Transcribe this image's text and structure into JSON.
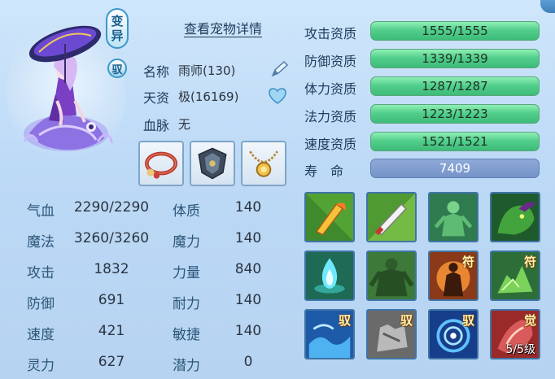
{
  "header": {
    "detail_link": "查看宠物详情",
    "mutant_badge": [
      "变",
      "异"
    ],
    "tame_badge": "驭"
  },
  "pet_info": {
    "name_label": "名称",
    "name_value": "雨师(130)",
    "talent_label": "天资",
    "talent_value": "极(16169)",
    "bloodline_label": "血脉",
    "bloodline_value": "无"
  },
  "equipment": [
    {
      "name": "collar",
      "color": "#b8362e"
    },
    {
      "name": "armor",
      "color": "#4a5b6e"
    },
    {
      "name": "necklace",
      "color": "#d9a23c"
    }
  ],
  "stats": [
    {
      "label": "气血",
      "value": "2290/2290",
      "label2": "体质",
      "value2": "140"
    },
    {
      "label": "魔法",
      "value": "3260/3260",
      "label2": "魔力",
      "value2": "140"
    },
    {
      "label": "攻击",
      "value": "1832",
      "label2": "力量",
      "value2": "840"
    },
    {
      "label": "防御",
      "value": "691",
      "label2": "耐力",
      "value2": "140"
    },
    {
      "label": "速度",
      "value": "421",
      "label2": "敏捷",
      "value2": "140"
    },
    {
      "label": "灵力",
      "value": "627",
      "label2": "潜力",
      "value2": "0"
    }
  ],
  "aptitudes": [
    {
      "label": "攻击资质",
      "value": "1555/1555"
    },
    {
      "label": "防御资质",
      "value": "1339/1339"
    },
    {
      "label": "体力资质",
      "value": "1287/1287"
    },
    {
      "label": "法力资质",
      "value": "1223/1223"
    },
    {
      "label": "速度资质",
      "value": "1521/1521"
    }
  ],
  "lifespan": {
    "label": "寿　命",
    "value": "7409"
  },
  "skills": [
    {
      "icon": "flame-sword-icon",
      "tag": "",
      "level": ""
    },
    {
      "icon": "blade-strike-icon",
      "tag": "",
      "level": ""
    },
    {
      "icon": "green-figure-icon",
      "tag": "",
      "level": ""
    },
    {
      "icon": "shadow-beast-icon",
      "tag": "",
      "level": ""
    },
    {
      "icon": "blue-flame-icon",
      "tag": "",
      "level": ""
    },
    {
      "icon": "giant-icon",
      "tag": "",
      "level": ""
    },
    {
      "icon": "fire-warrior-icon",
      "tag": "符",
      "level": ""
    },
    {
      "icon": "green-burst-icon",
      "tag": "符",
      "level": ""
    },
    {
      "icon": "water-wave-icon",
      "tag": "驭",
      "level": ""
    },
    {
      "icon": "stone-hand-icon",
      "tag": "驭",
      "level": ""
    },
    {
      "icon": "vortex-icon",
      "tag": "驭",
      "level": ""
    },
    {
      "icon": "awaken-icon",
      "tag": "觉",
      "level": "5/5级"
    }
  ],
  "colors": {
    "aptitude_bar": "#4fcb88",
    "life_bar": "#7d9bcc",
    "label_text": "#1e3b5a"
  }
}
